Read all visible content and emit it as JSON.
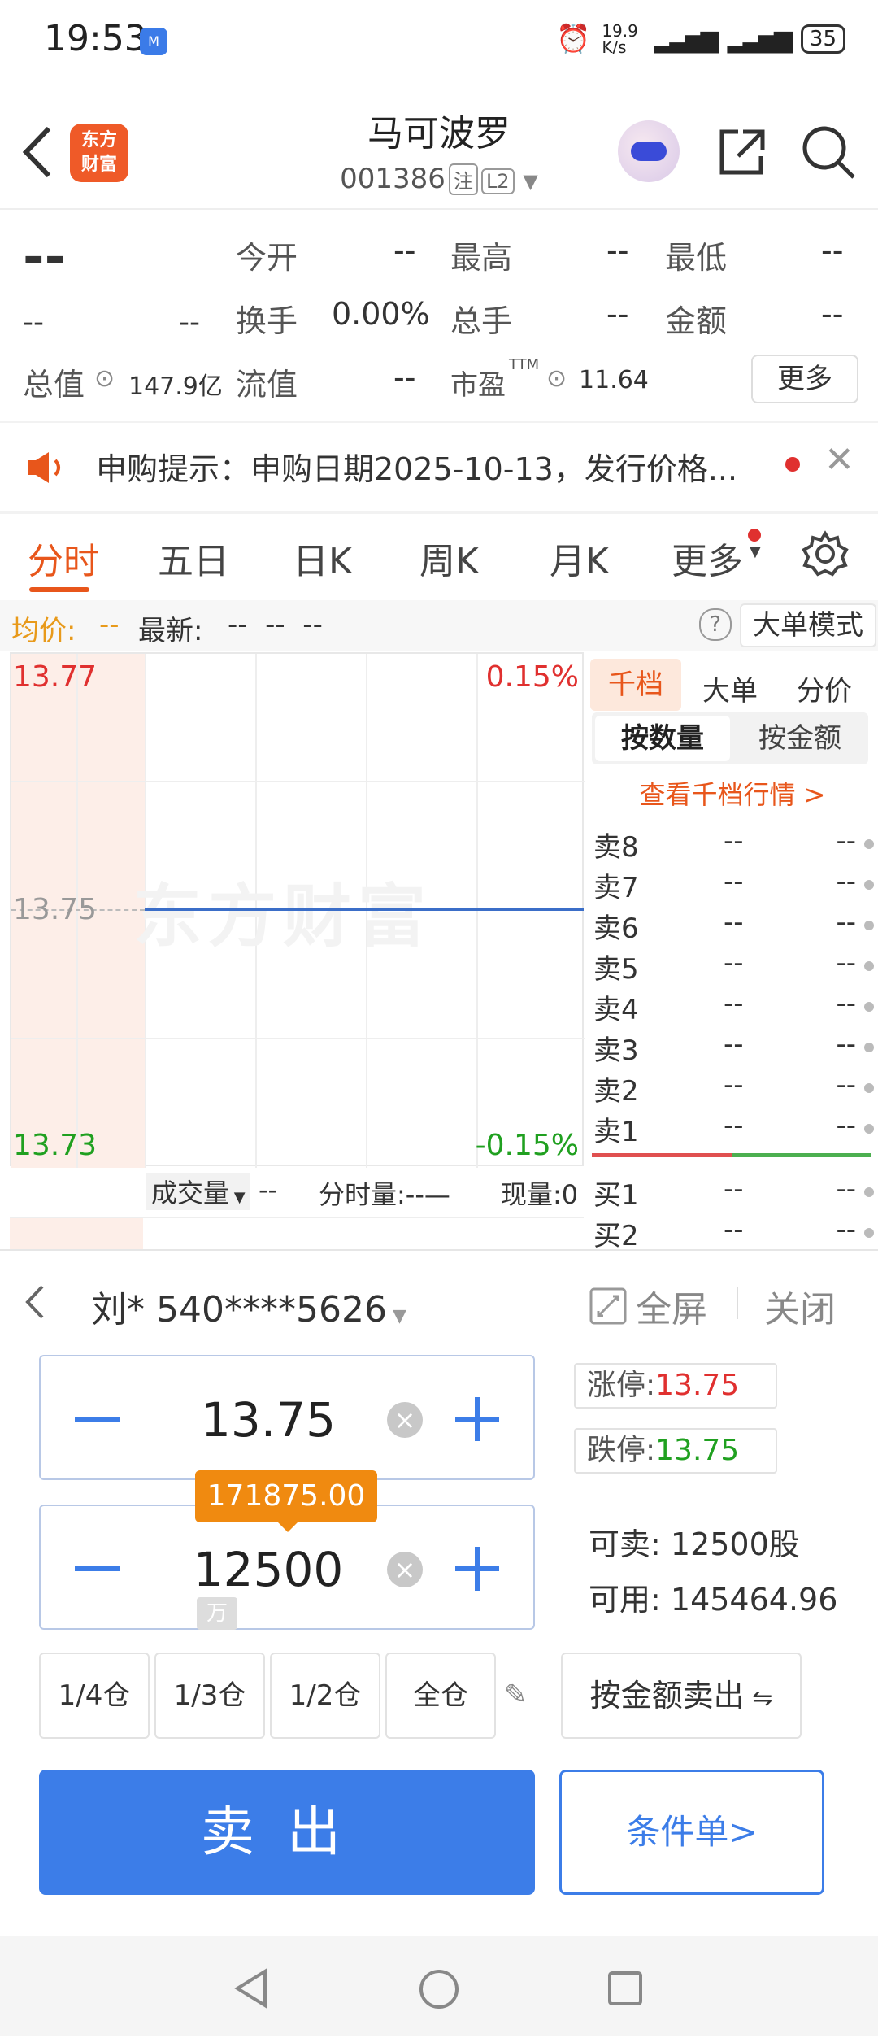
{
  "status_bar": {
    "time": "19:53",
    "app_badge": "M",
    "net_speed": "19.9 K/s",
    "battery": "35"
  },
  "header": {
    "title": "马可波罗",
    "code": "001386",
    "tag1": "注",
    "tag2": "L2",
    "logo_text1": "东方",
    "logo_text2": "财富"
  },
  "quote": {
    "price": "--",
    "sub1": "--",
    "sub2": "--",
    "fields": [
      {
        "label": "今开",
        "value": "--"
      },
      {
        "label": "最高",
        "value": "--"
      },
      {
        "label": "最低",
        "value": "--"
      },
      {
        "label": "换手",
        "value": "0.00%"
      },
      {
        "label": "总手",
        "value": "--"
      },
      {
        "label": "金额",
        "value": "--"
      },
      {
        "label": "总值",
        "value": "147.9亿"
      },
      {
        "label": "流值",
        "value": "--"
      },
      {
        "label": "市盈",
        "value": "11.64"
      }
    ],
    "pe_sup": "TTM",
    "more_label": "更多"
  },
  "notice": {
    "text": "申购提示：申购日期2025-10-13，发行价格..."
  },
  "tabs": [
    {
      "label": "分时"
    },
    {
      "label": "五日"
    },
    {
      "label": "日K"
    },
    {
      "label": "周K"
    },
    {
      "label": "月K"
    },
    {
      "label": "更多"
    }
  ],
  "info_row": {
    "avg_label": "均价:",
    "avg_value": "--",
    "latest_label": "最新:",
    "latest_values": "--  --  --",
    "mode_label": "大单模式"
  },
  "chart": {
    "y_top": "13.77",
    "y_mid": "13.75",
    "y_bottom": "13.73",
    "pct_top": "0.15%",
    "pct_bottom": "-0.15%",
    "watermark": "东方财富",
    "vol_label": "成交量",
    "vol_value": "--",
    "minute_vol": "分时量:--—",
    "now_vol": "现量:0",
    "colors": {
      "up": "#e0302f",
      "down": "#20a020",
      "line": "#3b6ec8"
    }
  },
  "book": {
    "tabs": [
      "千档",
      "大单",
      "分价"
    ],
    "sub_tabs": [
      "按数量",
      "按金额"
    ],
    "link": "查看千档行情 >",
    "sells": [
      {
        "label": "卖8",
        "p": "--",
        "v": "--"
      },
      {
        "label": "卖7",
        "p": "--",
        "v": "--"
      },
      {
        "label": "卖6",
        "p": "--",
        "v": "--"
      },
      {
        "label": "卖5",
        "p": "--",
        "v": "--"
      },
      {
        "label": "卖4",
        "p": "--",
        "v": "--"
      },
      {
        "label": "卖3",
        "p": "--",
        "v": "--"
      },
      {
        "label": "卖2",
        "p": "--",
        "v": "--"
      },
      {
        "label": "卖1",
        "p": "--",
        "v": "--"
      }
    ],
    "buys": [
      {
        "label": "买1",
        "p": "--",
        "v": "--"
      },
      {
        "label": "买2",
        "p": "--",
        "v": "--"
      }
    ]
  },
  "trade": {
    "account": "刘* 540****5626",
    "fullscreen": "全屏",
    "close": "关闭",
    "price": "13.75",
    "qty": "12500",
    "amount_tip": "171875.00",
    "unit_tip": "万",
    "limit_up_label": "涨停:",
    "limit_up": "13.75",
    "limit_down_label": "跌停:",
    "limit_down": "13.75",
    "sellable_label": "可卖:",
    "sellable": "12500股",
    "available_label": "可用:",
    "available": "145464.96",
    "positions": [
      "1/4仓",
      "1/3仓",
      "1/2仓",
      "全仓"
    ],
    "by_amount": "按金额卖出",
    "sell_label": "卖出",
    "cond_label": "条件单>"
  }
}
